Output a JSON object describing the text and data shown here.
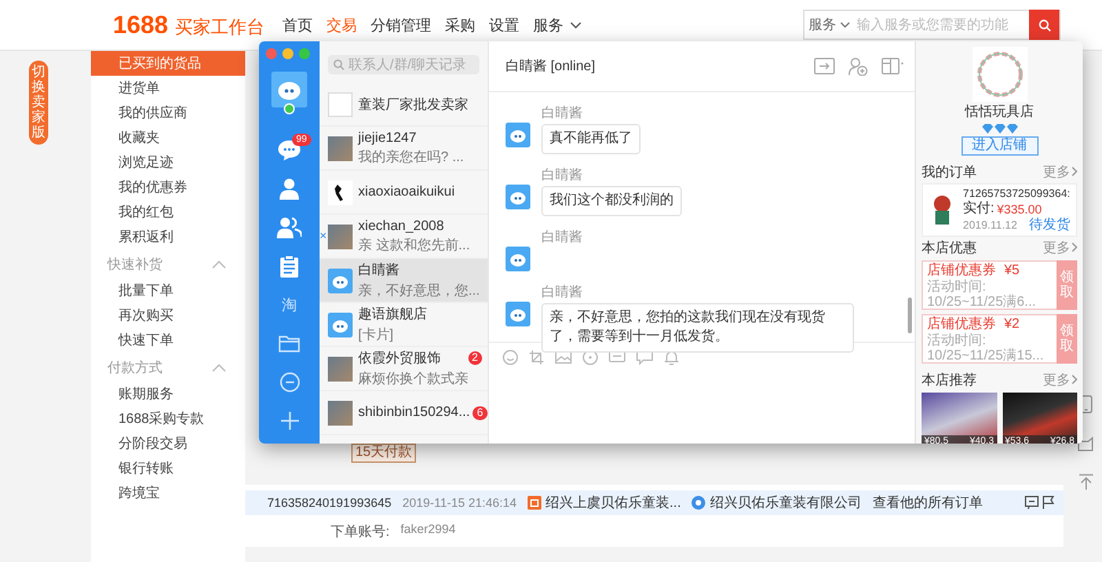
{
  "header": {
    "logo": "1688",
    "title": "买家工作台",
    "nav": [
      {
        "label": "首页",
        "selected": false,
        "dropdown": false
      },
      {
        "label": "交易",
        "selected": true,
        "dropdown": false
      },
      {
        "label": "分销管理",
        "selected": false,
        "dropdown": false
      },
      {
        "label": "采购",
        "selected": false,
        "dropdown": false
      },
      {
        "label": "设置",
        "selected": false,
        "dropdown": false
      },
      {
        "label": "服务",
        "selected": false,
        "dropdown": true
      }
    ],
    "search": {
      "scope": "服务",
      "placeholder": "输入服务或您需要的功能"
    }
  },
  "switch_tab": "切换卖家版",
  "sidebar": {
    "sections": [
      {
        "items": [
          {
            "label": "已买到的货品",
            "selected": true
          },
          {
            "label": "进货单",
            "selected": false
          },
          {
            "label": "我的供应商",
            "selected": false
          },
          {
            "label": "收藏夹",
            "selected": false
          },
          {
            "label": "浏览足迹",
            "selected": false
          },
          {
            "label": "我的优惠券",
            "selected": false
          },
          {
            "label": "我的红包",
            "selected": false
          },
          {
            "label": "累积返利",
            "selected": false
          }
        ]
      },
      {
        "title": "快速补货",
        "expanded": true,
        "items": [
          {
            "label": "批量下单",
            "selected": false
          },
          {
            "label": "再次购买",
            "selected": false
          },
          {
            "label": "快速下单",
            "selected": false
          }
        ]
      },
      {
        "title": "付款方式",
        "expanded": true,
        "items": [
          {
            "label": "账期服务",
            "selected": false
          },
          {
            "label": "1688采购专款",
            "selected": false
          },
          {
            "label": "分阶段交易",
            "selected": false
          },
          {
            "label": "银行转账",
            "selected": false
          },
          {
            "label": "跨境宝",
            "selected": false
          }
        ]
      }
    ]
  },
  "chat_window": {
    "rail": [
      {
        "kind": "avatar",
        "online": true
      },
      {
        "kind": "chat",
        "badge": "99"
      },
      {
        "kind": "person"
      },
      {
        "kind": "group"
      },
      {
        "kind": "notes"
      },
      {
        "kind": "text",
        "label": "淘"
      },
      {
        "kind": "folder"
      },
      {
        "kind": "minus"
      },
      {
        "kind": "plus"
      }
    ],
    "search_placeholder": "联系人/群/聊天记录",
    "contacts": [
      {
        "kind": "logo",
        "name": "童装厂家批发卖家",
        "selected": false
      },
      {
        "kind": "photo",
        "name": "jiejie1247",
        "preview": "我的亲您在吗? ...",
        "selected": false
      },
      {
        "kind": "sketch",
        "name": "xiaoxiaoaikuikui",
        "selected": false
      },
      {
        "kind": "photo",
        "name": "xiechan_2008",
        "preview": "亲 这款和您先前...",
        "close": "×",
        "selected": false
      },
      {
        "kind": "mascot",
        "name": "白睛酱",
        "preview": "亲，不好意思，您...",
        "selected": true
      },
      {
        "kind": "mascot",
        "name": "趣语旗舰店",
        "preview": "[卡片]",
        "selected": false
      },
      {
        "kind": "photo",
        "name": "依霞外贸服饰",
        "preview": "麻烦你换个款式亲",
        "badge": "2",
        "selected": false
      },
      {
        "kind": "photo",
        "name": "shibinbin150294...",
        "badge": "6",
        "selected": false
      }
    ],
    "conversation": {
      "title": "白睛酱 [online]",
      "messages": [
        {
          "kind": "text",
          "sender": "白睛酱",
          "text": "真不能再低了"
        },
        {
          "kind": "text",
          "sender": "白睛酱",
          "text": "我们这个都没利润的"
        },
        {
          "kind": "blank",
          "sender": "白睛酱"
        },
        {
          "kind": "text",
          "sender": "白睛酱",
          "text": "亲，不好意思，您拍的这款我们现在没有现货了，需要等到十一月低发货。"
        }
      ]
    },
    "store": {
      "name": "恬恬玩具店",
      "stars": 3,
      "enter_button": "进入店铺",
      "orders": {
        "title": "我的订单",
        "more": "更多",
        "number": "71265753725099364:",
        "paid_label": "实付:",
        "amount": "¥335.00",
        "date": "2019.11.12",
        "status": "待发货"
      },
      "coupons": {
        "title": "本店优惠",
        "more": "更多",
        "items": [
          {
            "name": "店铺优惠券",
            "value": "¥5",
            "period": "活动时间: 10/25~11/25满6...",
            "action": "领取"
          },
          {
            "name": "店铺优惠券",
            "value": "¥2",
            "period": "活动时间: 10/25~11/25满15...",
            "action": "领取"
          }
        ]
      },
      "recommend": {
        "title": "本店推荐",
        "more": "更多",
        "items": [
          {
            "original_price": "¥80.5",
            "price": "¥40.3"
          },
          {
            "original_price": "¥53.6",
            "price": "¥26.8"
          }
        ]
      }
    }
  },
  "page": {
    "tag": "15天付款",
    "order": {
      "number": "716358240191993645",
      "time": "2019-11-15 21:46:14",
      "shop": "绍兴上虞贝佑乐童装...",
      "company": "绍兴贝佑乐童装有限公司",
      "link": "查看他的所有订单",
      "account_label": "下单账号:",
      "account": "faker2994"
    }
  }
}
